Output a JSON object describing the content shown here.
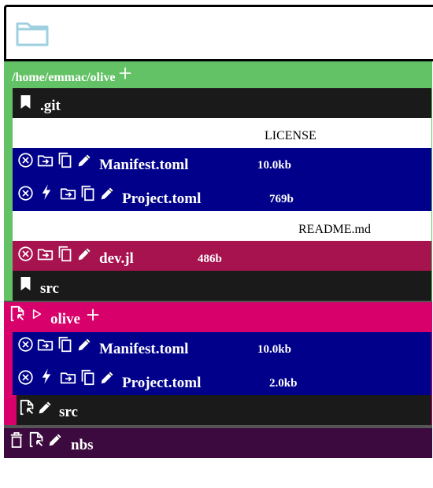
{
  "toolbar": {
    "folder_icon": "folder-icon"
  },
  "home_dir": {
    "path": "/home/emmac/olive",
    "color": "#64c266",
    "items": [
      {
        "name": ".git",
        "type": "directory"
      },
      {
        "name": "LICENSE",
        "type": "plain"
      },
      {
        "name": "Manifest.toml",
        "size": "10.0kb",
        "type": "toml"
      },
      {
        "name": "Project.toml",
        "size": "769b",
        "type": "toml"
      },
      {
        "name": "README.md",
        "type": "plain"
      },
      {
        "name": "dev.jl",
        "size": "486b",
        "type": "julia"
      },
      {
        "name": "src",
        "type": "directory"
      }
    ]
  },
  "olive_dir": {
    "name": "olive",
    "color": "#d8006a",
    "items": [
      {
        "name": "Manifest.toml",
        "size": "10.0kb",
        "type": "toml"
      },
      {
        "name": "Project.toml",
        "size": "2.0kb",
        "type": "toml"
      },
      {
        "name": "src",
        "type": "directory"
      }
    ]
  },
  "nbs_dir": {
    "name": "nbs",
    "color": "#3d0a3f"
  },
  "colors": {
    "toml": "#00008b",
    "julia": "#a6134e",
    "directory": "#1a1a1a"
  }
}
